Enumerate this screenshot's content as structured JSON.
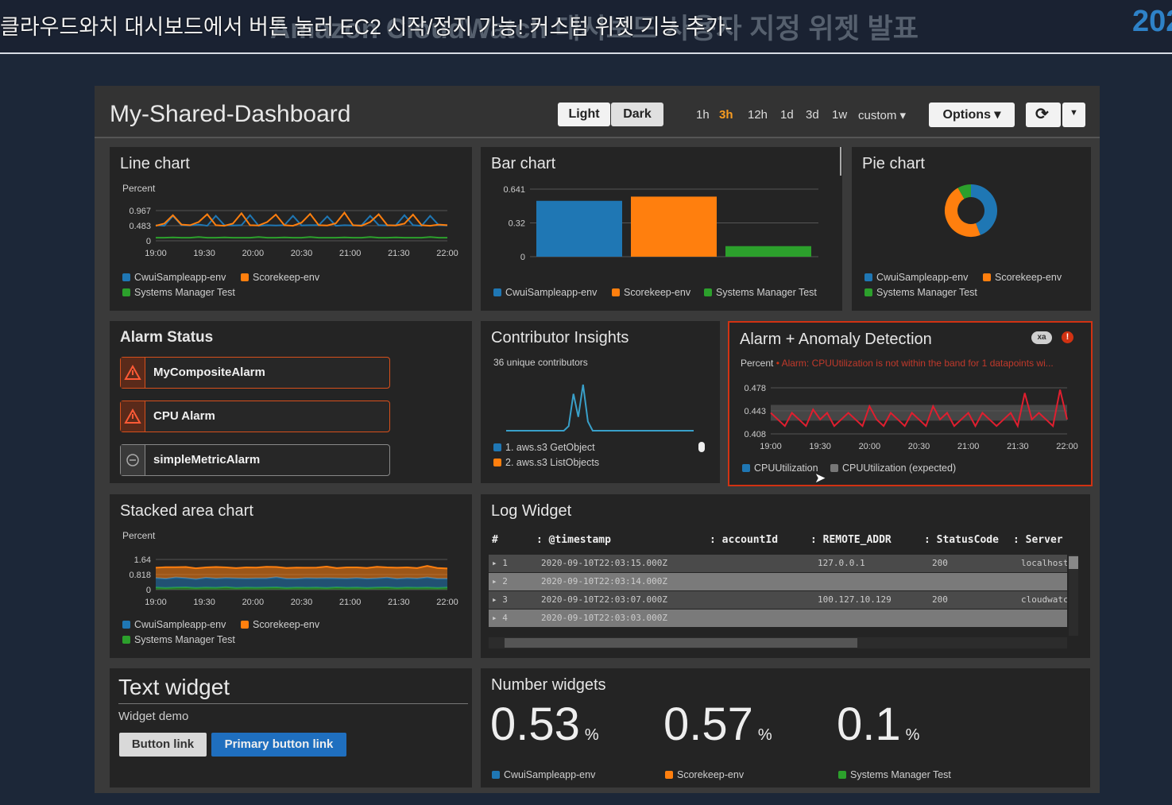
{
  "overlay": {
    "subtitle": "클라우드와치 대시보드에서 버튼 눌러 EC2 시작/정지 가능! 커스텀 위젯 기능 추가-",
    "slide_title": "Amazon CloudWatch 대시보드 사용자 지정 위젯 발표",
    "corner": "202"
  },
  "dashboard": {
    "title": "My-Shared-Dashboard",
    "theme_light": "Light",
    "theme_dark": "Dark",
    "ranges": [
      "1h",
      "3h",
      "12h",
      "1d",
      "3d",
      "1w"
    ],
    "active_range": "3h",
    "custom": "custom ▾",
    "options": "Options ▾",
    "refresh_icon": "refresh-icon",
    "accent": "#f89c21",
    "series_colors": {
      "cwui": "#1f77b4",
      "scorekeep": "#ff7f0e",
      "ssm": "#2ca02c"
    }
  },
  "line_widget": {
    "title": "Line chart",
    "unit": "Percent",
    "legend": [
      "CwuiSampleapp-env",
      "Scorekeep-env",
      "Systems Manager Test"
    ]
  },
  "bar_widget": {
    "title": "Bar chart",
    "legend": [
      "CwuiSampleapp-env",
      "Scorekeep-env",
      "Systems Manager Test"
    ]
  },
  "pie_widget": {
    "title": "Pie chart",
    "legend": [
      "CwuiSampleapp-env",
      "Scorekeep-env",
      "Systems Manager Test"
    ]
  },
  "alarm_widget": {
    "title": "Alarm Status",
    "alarms": [
      {
        "name": "MyCompositeAlarm",
        "state": "alarm"
      },
      {
        "name": "CPU Alarm",
        "state": "alarm"
      },
      {
        "name": "simpleMetricAlarm",
        "state": "insufficient"
      }
    ]
  },
  "contrib_widget": {
    "title": "Contributor Insights",
    "subtitle": "36 unique contributors",
    "legend": [
      "1. aws.s3 GetObject",
      "2. aws.s3 ListObjects"
    ]
  },
  "anomaly_widget": {
    "title": "Alarm + Anomaly Detection",
    "badge": "xa",
    "unit": "Percent",
    "message": "Alarm: CPUUtilization is not within the band for 1 datapoints wi...",
    "legend": [
      "CPUUtilization",
      "CPUUtilization (expected)"
    ]
  },
  "stacked_widget": {
    "title": "Stacked area chart",
    "unit": "Percent",
    "legend": [
      "CwuiSampleapp-env",
      "Scorekeep-env",
      "Systems Manager Test"
    ]
  },
  "log_widget": {
    "title": "Log Widget",
    "columns": [
      "#",
      "@timestamp",
      "accountId",
      "REMOTE_ADDR",
      "StatusCode",
      "Server"
    ],
    "rows": [
      {
        "n": "1",
        "ts": "2020-09-10T22:03:15.000Z",
        "acct": "",
        "addr": "127.0.0.1",
        "code": "200",
        "server": "localhost"
      },
      {
        "n": "2",
        "ts": "2020-09-10T22:03:14.000Z",
        "acct": "",
        "addr": "",
        "code": "",
        "server": ""
      },
      {
        "n": "3",
        "ts": "2020-09-10T22:03:07.000Z",
        "acct": "",
        "addr": "100.127.10.129",
        "code": "200",
        "server": "cloudwatc"
      },
      {
        "n": "4",
        "ts": "2020-09-10T22:03:03.000Z",
        "acct": "",
        "addr": "",
        "code": "",
        "server": ""
      }
    ]
  },
  "text_widget": {
    "title": "Text widget",
    "body": "Widget demo",
    "button": "Button link",
    "primary_button": "Primary button link"
  },
  "number_widget": {
    "title": "Number widgets",
    "items": [
      {
        "value": "0.53",
        "unit": "%",
        "label": "CwuiSampleapp-env",
        "color": "#1f77b4"
      },
      {
        "value": "0.57",
        "unit": "%",
        "label": "Scorekeep-env",
        "color": "#ff7f0e"
      },
      {
        "value": "0.1",
        "unit": "%",
        "label": "Systems Manager Test",
        "color": "#2ca02c"
      }
    ]
  },
  "chart_data": [
    {
      "type": "line",
      "title": "Line chart",
      "ylabel": "Percent",
      "ylim": [
        0,
        0.967
      ],
      "yticks": [
        "0.967",
        "0.483",
        "0"
      ],
      "xticks": [
        "19:00",
        "19:30",
        "20:00",
        "20:30",
        "21:00",
        "21:30",
        "22:00"
      ],
      "series": [
        {
          "name": "CwuiSampleapp-env",
          "values": [
            0.5,
            0.48,
            0.8,
            0.5,
            0.49,
            0.52,
            0.48,
            0.8,
            0.5,
            0.49,
            0.5,
            0.82,
            0.48,
            0.5,
            0.49,
            0.5,
            0.8,
            0.49,
            0.5,
            0.5,
            0.78,
            0.48,
            0.5,
            0.49,
            0.5,
            0.8,
            0.5,
            0.49,
            0.5,
            0.82,
            0.5,
            0.48,
            0.8,
            0.5,
            0.49
          ]
        },
        {
          "name": "Scorekeep-env",
          "values": [
            0.48,
            0.55,
            0.82,
            0.52,
            0.5,
            0.6,
            0.85,
            0.5,
            0.48,
            0.55,
            0.88,
            0.5,
            0.49,
            0.6,
            0.84,
            0.5,
            0.48,
            0.58,
            0.86,
            0.5,
            0.49,
            0.56,
            0.9,
            0.5,
            0.48,
            0.6,
            0.85,
            0.5,
            0.49,
            0.55,
            0.84,
            0.5,
            0.48,
            0.52,
            0.5
          ]
        },
        {
          "name": "Systems Manager Test",
          "values": [
            0.1,
            0.1,
            0.11,
            0.1,
            0.1,
            0.12,
            0.1,
            0.1,
            0.11,
            0.1,
            0.1,
            0.1,
            0.12,
            0.1,
            0.1,
            0.11,
            0.1,
            0.1,
            0.12,
            0.1,
            0.1,
            0.1,
            0.11,
            0.1,
            0.1,
            0.12,
            0.1,
            0.1,
            0.11,
            0.1,
            0.1,
            0.1,
            0.12,
            0.1,
            0.1
          ]
        }
      ]
    },
    {
      "type": "bar",
      "title": "Bar chart",
      "ylim": [
        0,
        0.641
      ],
      "yticks": [
        "0.641",
        "0.32",
        "0"
      ],
      "categories": [
        "CwuiSampleapp-env",
        "Scorekeep-env",
        "Systems Manager Test"
      ],
      "values": [
        0.53,
        0.57,
        0.1
      ]
    },
    {
      "type": "pie",
      "title": "Pie chart",
      "categories": [
        "CwuiSampleapp-env",
        "Scorekeep-env",
        "Systems Manager Test"
      ],
      "values": [
        0.53,
        0.57,
        0.1
      ]
    },
    {
      "type": "line",
      "title": "Contributor Insights",
      "series": [
        {
          "name": "1. aws.s3 GetObject",
          "values": [
            0,
            0,
            0,
            0,
            0,
            0,
            0,
            0,
            0,
            0,
            0,
            0,
            0,
            0.1,
            0.8,
            0.3,
            1,
            0.2,
            0,
            0,
            0,
            0,
            0,
            0,
            0,
            0,
            0,
            0,
            0,
            0,
            0,
            0,
            0,
            0,
            0,
            0,
            0,
            0,
            0,
            0
          ]
        }
      ]
    },
    {
      "type": "line",
      "title": "Alarm + Anomaly Detection",
      "ylabel": "Percent",
      "ylim": [
        0.408,
        0.478
      ],
      "yticks": [
        "0.478",
        "0.443",
        "0.408"
      ],
      "xticks": [
        "19:00",
        "19:30",
        "20:00",
        "20:30",
        "21:00",
        "21:30",
        "22:00"
      ],
      "series": [
        {
          "name": "CPUUtilization",
          "values": [
            0.44,
            0.43,
            0.42,
            0.44,
            0.43,
            0.42,
            0.445,
            0.43,
            0.44,
            0.42,
            0.43,
            0.44,
            0.43,
            0.42,
            0.45,
            0.43,
            0.42,
            0.44,
            0.43,
            0.42,
            0.44,
            0.43,
            0.42,
            0.45,
            0.43,
            0.44,
            0.42,
            0.43,
            0.44,
            0.42,
            0.44,
            0.43,
            0.42,
            0.43,
            0.44,
            0.42,
            0.47,
            0.43,
            0.44,
            0.43,
            0.42,
            0.475,
            0.43
          ]
        },
        {
          "name": "CPUUtilization (expected)",
          "values": [
            0.44,
            0.44,
            0.44,
            0.44,
            0.44,
            0.44,
            0.44,
            0.44,
            0.44,
            0.44,
            0.44,
            0.44,
            0.44,
            0.44,
            0.44,
            0.44,
            0.44,
            0.44,
            0.44,
            0.44,
            0.44,
            0.44,
            0.44,
            0.44,
            0.44,
            0.44,
            0.44,
            0.44,
            0.44,
            0.44,
            0.44,
            0.44,
            0.44,
            0.44,
            0.44,
            0.44,
            0.44,
            0.44,
            0.44,
            0.44,
            0.44,
            0.44,
            0.44
          ]
        }
      ]
    },
    {
      "type": "area",
      "title": "Stacked area chart",
      "ylabel": "Percent",
      "ylim": [
        0,
        1.64
      ],
      "yticks": [
        "1.64",
        "0.818",
        "0"
      ],
      "xticks": [
        "19:00",
        "19:30",
        "20:00",
        "20:30",
        "21:00",
        "21:30",
        "22:00"
      ],
      "series": [
        {
          "name": "CwuiSampleapp-env",
          "values": [
            0.52,
            0.5,
            0.55,
            0.5,
            0.48,
            0.53,
            0.5,
            0.5,
            0.52,
            0.49,
            0.51,
            0.5,
            0.55,
            0.5,
            0.48,
            0.52,
            0.5,
            0.53,
            0.49,
            0.5,
            0.52,
            0.5,
            0.5,
            0.53,
            0.49,
            0.51,
            0.5,
            0.55,
            0.5,
            0.48
          ]
        },
        {
          "name": "Scorekeep-env",
          "values": [
            0.55,
            0.62,
            0.55,
            0.6,
            0.58,
            0.56,
            0.62,
            0.57,
            0.55,
            0.6,
            0.58,
            0.62,
            0.55,
            0.58,
            0.6,
            0.56,
            0.58,
            0.62,
            0.55,
            0.6,
            0.57,
            0.58,
            0.62,
            0.55,
            0.6,
            0.58,
            0.56,
            0.62,
            0.58,
            0.55
          ]
        },
        {
          "name": "Systems Manager Test",
          "values": [
            0.12,
            0.1,
            0.12,
            0.13,
            0.1,
            0.12,
            0.11,
            0.14,
            0.1,
            0.12,
            0.11,
            0.12,
            0.13,
            0.1,
            0.12,
            0.11,
            0.12,
            0.1,
            0.13,
            0.11,
            0.12,
            0.1,
            0.12,
            0.13,
            0.1,
            0.12,
            0.11,
            0.12,
            0.1,
            0.12
          ]
        }
      ]
    }
  ]
}
